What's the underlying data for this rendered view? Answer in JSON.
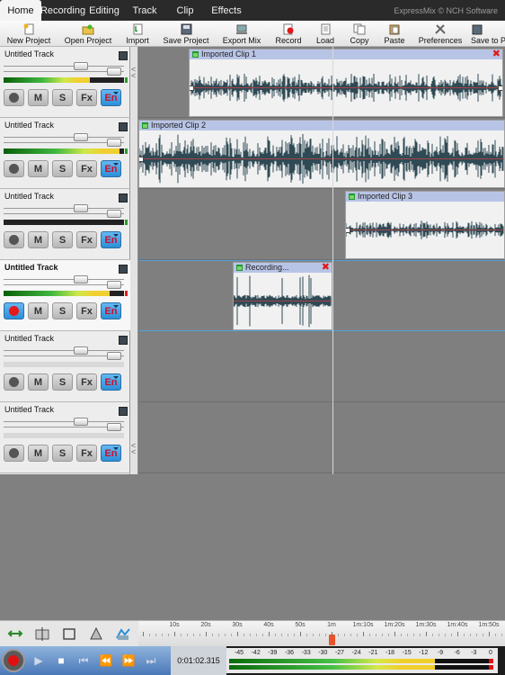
{
  "menubar": {
    "tabs": [
      {
        "label": "Home",
        "active": true
      },
      {
        "label": "Recording",
        "active": false
      },
      {
        "label": "Editing",
        "active": false
      },
      {
        "label": "Track",
        "active": false
      },
      {
        "label": "Clip",
        "active": false
      },
      {
        "label": "Effects",
        "active": false
      }
    ],
    "brand": "ExpressMix © NCH Software"
  },
  "toolbar": {
    "items": [
      {
        "label": "New Project",
        "icon": "new-project-icon"
      },
      {
        "label": "Open Project",
        "icon": "open-project-icon"
      },
      {
        "label": "Import",
        "icon": "import-icon"
      },
      {
        "label": "Save Project",
        "icon": "save-project-icon"
      },
      {
        "label": "Export Mix",
        "icon": "export-mix-icon"
      },
      {
        "label": "Record",
        "icon": "record-icon"
      },
      {
        "label": "Load",
        "icon": "load-icon"
      },
      {
        "label": "Copy",
        "icon": "copy-icon"
      },
      {
        "label": "Paste",
        "icon": "paste-icon"
      },
      {
        "label": "Preferences",
        "icon": "preferences-icon"
      },
      {
        "label": "Save to P",
        "icon": "save-to-icon"
      }
    ]
  },
  "tracks": [
    {
      "name": "Untitled Track",
      "level": 0.72,
      "armed": false,
      "selected": false
    },
    {
      "name": "Untitled Track",
      "level": 0.96,
      "armed": false,
      "selected": false
    },
    {
      "name": "Untitled Track",
      "level": 0.0,
      "armed": false,
      "selected": false
    },
    {
      "name": "Untitled Track",
      "level": 0.88,
      "armed": true,
      "selected": true
    },
    {
      "name": "Untitled Track",
      "level": null,
      "armed": false,
      "selected": false
    },
    {
      "name": "Untitled Track",
      "level": null,
      "armed": false,
      "selected": false
    }
  ],
  "track_buttons": {
    "mute": "M",
    "solo": "S",
    "fx": "Fx",
    "envelope": "En"
  },
  "clips": [
    {
      "title": "Imported Clip 1",
      "closable": true
    },
    {
      "title": "Imported Clip 2",
      "closable": false
    },
    {
      "title": "Imported Clip 3",
      "closable": false
    },
    {
      "title": "Recording...",
      "closable": true
    }
  ],
  "ruler": {
    "labels": [
      "10s",
      "20s",
      "30s",
      "40s",
      "50s",
      "1m",
      "1m:10s",
      "1m:20s",
      "1m:30s",
      "1m:40s",
      "1m:50s"
    ],
    "playhead_seconds": 61
  },
  "bottom_tools": [
    "move-tool-icon",
    "split-tool-icon",
    "select-tool-icon",
    "fade-tool-icon",
    "envelope-tool-icon"
  ],
  "transport": {
    "time": "0:01:02.315",
    "meter_scale": [
      "-45",
      "-42",
      "-39",
      "-36",
      "-33",
      "-30",
      "-27",
      "-24",
      "-21",
      "-18",
      "-15",
      "-12",
      "-9",
      "-6",
      "-3",
      "0"
    ],
    "meter_level": 0.78
  },
  "colors": {
    "menubar": "#2a2a2a",
    "clip_header": "#b8c4e6",
    "waveform": "#2f4a55",
    "record_red": "#e01010",
    "en_blue": "#2c8fd7"
  }
}
